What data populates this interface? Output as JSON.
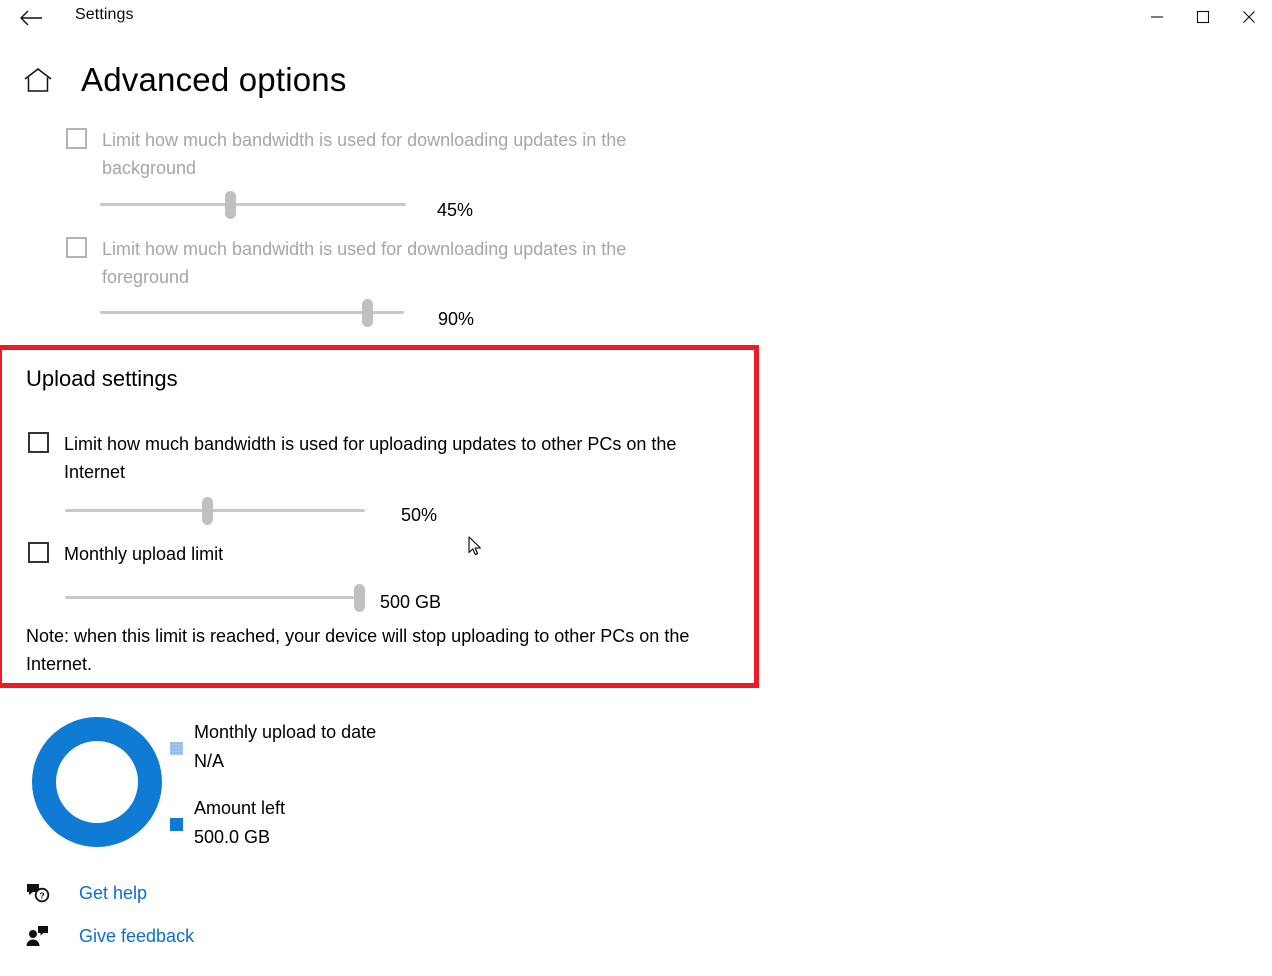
{
  "window": {
    "app_title": "Settings",
    "back_icon": "back-arrow-icon",
    "controls": {
      "minimize": "minimize-icon",
      "maximize": "maximize-icon",
      "close": "close-icon"
    }
  },
  "header": {
    "home_icon": "home-icon",
    "title": "Advanced options"
  },
  "download_settings": {
    "background": {
      "label": "Limit how much bandwidth is used for downloading updates in the background",
      "checked": false,
      "enabled": false,
      "value_label": "45%",
      "value": 45
    },
    "foreground": {
      "label": "Limit how much bandwidth is used for downloading updates in the foreground",
      "checked": false,
      "enabled": false,
      "value_label": "90%",
      "value": 90
    }
  },
  "upload_settings": {
    "section_title": "Upload settings",
    "highlight_color": "#ED1C24",
    "bandwidth": {
      "label": "Limit how much bandwidth is used for uploading updates to other PCs on the Internet",
      "checked": false,
      "enabled": true,
      "value_label": "50%",
      "value": 50
    },
    "monthly_limit": {
      "label": "Monthly upload limit",
      "checked": false,
      "enabled": true,
      "value_label": "500 GB",
      "value": 500
    },
    "note": "Note: when this limit is reached, your device will stop uploading to other PCs on the Internet."
  },
  "usage_chart": {
    "accent_color": "#0f7bd4",
    "legend": [
      {
        "swatch": "hatched",
        "label": "Monthly upload to date",
        "value": "N/A"
      },
      {
        "swatch": "solid",
        "label": "Amount left",
        "value": "500.0 GB"
      }
    ]
  },
  "footer": {
    "links": [
      {
        "icon": "help-bubble-icon",
        "label": "Get help"
      },
      {
        "icon": "feedback-person-icon",
        "label": "Give feedback"
      }
    ]
  }
}
